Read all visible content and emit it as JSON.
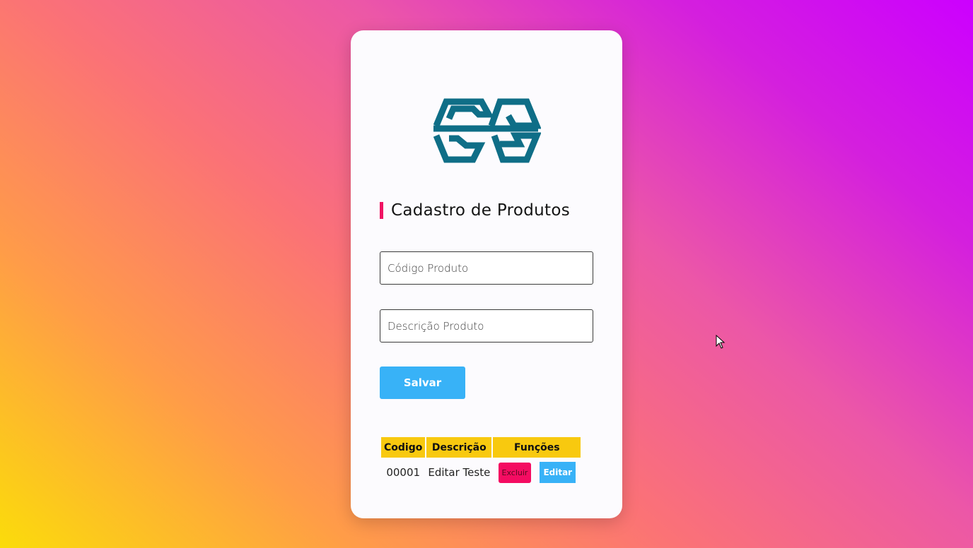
{
  "form": {
    "title": "Cadastro de Produtos",
    "code_placeholder": "Código Produto",
    "description_placeholder": "Descrição Produto",
    "code_value": "",
    "description_value": "",
    "save_label": "Salvar"
  },
  "logo": {
    "icon": "double-chain-logo-icon",
    "color": "#0f6e87"
  },
  "table": {
    "headers": [
      "Codigo",
      "Descrição",
      "Funções"
    ],
    "rows": [
      {
        "code": "00001",
        "description": "Editar Teste",
        "delete_label": "Excluir",
        "edit_label": "Editar"
      }
    ]
  },
  "colors": {
    "accent_pink": "#f01463",
    "button_blue": "#38b2f7",
    "header_yellow": "#f8c90f"
  }
}
